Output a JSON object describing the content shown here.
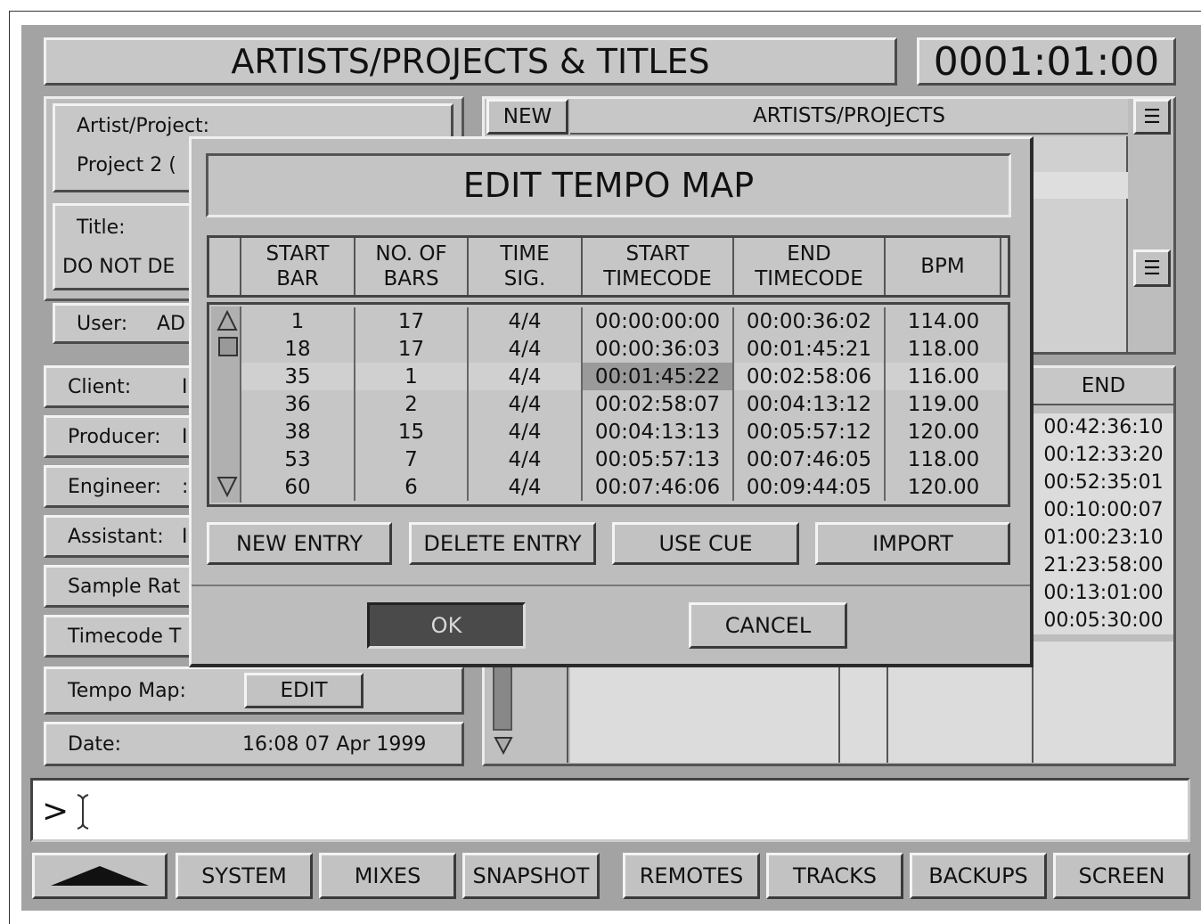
{
  "header": {
    "title": "ARTISTS/PROJECTS & TITLES",
    "timecode": "0001:01:00"
  },
  "left": {
    "artist_label": "Artist/Project:",
    "artist_value": "Project 2 (",
    "title_label": "Title:",
    "title_value": "DO NOT DE",
    "user_label": "User:",
    "user_value": "AD",
    "fields": [
      {
        "label": "Client:",
        "value": "I"
      },
      {
        "label": "Producer:",
        "value": "I"
      },
      {
        "label": "Engineer:",
        "value": ":"
      },
      {
        "label": "Assistant:",
        "value": "I"
      },
      {
        "label": "Sample Rat",
        "value": ""
      },
      {
        "label": "Timecode T",
        "value": ""
      }
    ],
    "tempo_label": "Tempo Map:",
    "tempo_button": "EDIT",
    "date_label": "Date:",
    "date_value": "16:08 07 Apr 1999"
  },
  "right": {
    "new_button": "NEW",
    "list_title": "ARTISTS/PROJECTS",
    "end_header": "END",
    "end_values": [
      "00:42:36:10",
      "00:12:33:20",
      "00:52:35:01",
      "00:10:00:07",
      "01:00:23:10",
      "21:23:58:00",
      "00:13:01:00",
      "00:05:30:00"
    ]
  },
  "dialog": {
    "title": "EDIT TEMPO MAP",
    "columns": [
      [
        "START",
        "BAR"
      ],
      [
        "NO. OF",
        "BARS"
      ],
      [
        "TIME",
        "SIG."
      ],
      [
        "START",
        "TIMECODE"
      ],
      [
        "END",
        "TIMECODE"
      ],
      [
        "BPM"
      ]
    ],
    "rows": [
      [
        "1",
        "17",
        "4/4",
        "00:00:00:00",
        "00:00:36:02",
        "114.00"
      ],
      [
        "18",
        "17",
        "4/4",
        "00:00:36:03",
        "00:01:45:21",
        "118.00"
      ],
      [
        "35",
        "1",
        "4/4",
        "00:01:45:22",
        "00:02:58:06",
        "116.00"
      ],
      [
        "36",
        "2",
        "4/4",
        "00:02:58:07",
        "00:04:13:12",
        "119.00"
      ],
      [
        "38",
        "15",
        "4/4",
        "00:04:13:13",
        "00:05:57:12",
        "120.00"
      ],
      [
        "53",
        "7",
        "4/4",
        "00:05:57:13",
        "00:07:46:05",
        "118.00"
      ],
      [
        "60",
        "6",
        "4/4",
        "00:07:46:06",
        "00:09:44:05",
        "120.00"
      ]
    ],
    "buttons": {
      "new_entry": "NEW ENTRY",
      "delete_entry": "DELETE ENTRY",
      "use_cue": "USE CUE",
      "import": "IMPORT",
      "ok": "OK",
      "cancel": "CANCEL"
    }
  },
  "command": {
    "prompt": ">"
  },
  "nav": {
    "system": "SYSTEM",
    "mixes": "MIXES",
    "snapshot": "SNAPSHOT",
    "remotes": "REMOTES",
    "tracks": "TRACKS",
    "backups": "BACKUPS",
    "screen": "SCREEN"
  },
  "colors": {
    "background": "#a3a3a3",
    "panel": "#bdbdbd",
    "ok_button": "#4a4a4a",
    "highlight": "#9a9a9a"
  }
}
